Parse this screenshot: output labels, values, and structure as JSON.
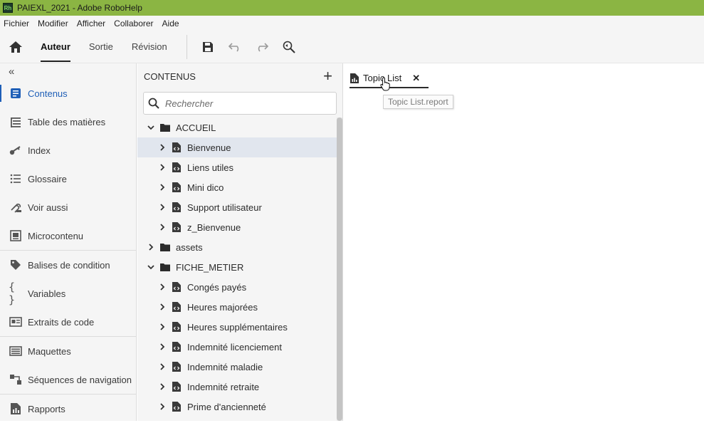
{
  "window": {
    "title": "PAIEXL_2021 - Adobe RoboHelp",
    "logo_text": "Rh"
  },
  "colors": {
    "titlebar": "#8bb543",
    "accent": "#1f5fb7",
    "selected_row": "#e1e6ee"
  },
  "menu": [
    "Fichier",
    "Modifier",
    "Afficher",
    "Collaborer",
    "Aide"
  ],
  "toolbar": {
    "home_icon": "home-icon",
    "tabs": [
      {
        "label": "Auteur",
        "active": true
      },
      {
        "label": "Sortie",
        "active": false
      },
      {
        "label": "Révision",
        "active": false
      }
    ],
    "icons": [
      "save-icon",
      "undo-icon",
      "redo-icon",
      "find-replace-icon"
    ]
  },
  "sidebar": {
    "collapse_glyph": "«",
    "items": [
      {
        "label": "Contenus",
        "icon": "contents-icon",
        "active": true
      },
      {
        "label": "Table des matières",
        "icon": "toc-icon"
      },
      {
        "label": "Index",
        "icon": "key-icon"
      },
      {
        "label": "Glossaire",
        "icon": "glossary-icon"
      },
      {
        "label": "Voir aussi",
        "icon": "see-also-icon"
      },
      {
        "label": "Microcontenu",
        "icon": "microcontent-icon"
      },
      {
        "label": "Balises de condition",
        "icon": "tag-icon"
      },
      {
        "label": "Variables",
        "icon": "braces-icon"
      },
      {
        "label": "Extraits de code",
        "icon": "snippet-icon"
      },
      {
        "label": "Maquettes",
        "icon": "template-icon"
      },
      {
        "label": "Séquences de navigation",
        "icon": "browse-sequence-icon"
      },
      {
        "label": "Rapports",
        "icon": "report-icon"
      }
    ]
  },
  "contents_panel": {
    "title": "CONTENUS",
    "add_glyph": "+",
    "search_placeholder": "Rechercher",
    "tree": [
      {
        "label": "ACCUEIL",
        "type": "folder",
        "expanded": true,
        "level": 0
      },
      {
        "label": "Bienvenue",
        "type": "topic",
        "level": 1,
        "selected": true
      },
      {
        "label": "Liens utiles",
        "type": "topic",
        "level": 1
      },
      {
        "label": "Mini dico",
        "type": "topic",
        "level": 1
      },
      {
        "label": "Support utilisateur",
        "type": "topic",
        "level": 1
      },
      {
        "label": "z_Bienvenue",
        "type": "topic",
        "level": 1
      },
      {
        "label": "assets",
        "type": "folder",
        "expanded": false,
        "level": 0
      },
      {
        "label": "FICHE_METIER",
        "type": "folder",
        "expanded": true,
        "level": 0
      },
      {
        "label": "Congés payés",
        "type": "topic",
        "level": 1
      },
      {
        "label": "Heures majorées",
        "type": "topic",
        "level": 1
      },
      {
        "label": "Heures supplémentaires",
        "type": "topic",
        "level": 1
      },
      {
        "label": "Indemnité licenciement",
        "type": "topic",
        "level": 1
      },
      {
        "label": "Indemnité maladie",
        "type": "topic",
        "level": 1
      },
      {
        "label": "Indemnité retraite",
        "type": "topic",
        "level": 1
      },
      {
        "label": "Prime d'ancienneté",
        "type": "topic",
        "level": 1
      }
    ]
  },
  "editor": {
    "tab_label": "Topic List",
    "tab_close_glyph": "✕",
    "tooltip": "Topic List.report"
  }
}
